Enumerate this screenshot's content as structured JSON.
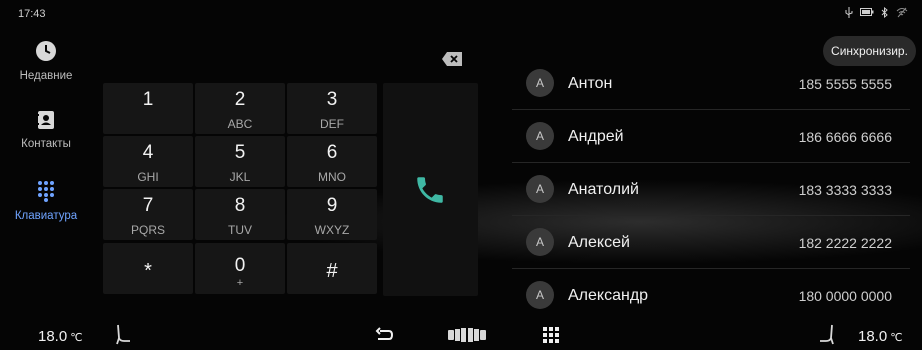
{
  "status": {
    "time": "17:43",
    "icons": [
      "usb-icon",
      "battery-icon",
      "bluetooth-icon",
      "wifi-off-icon"
    ]
  },
  "sidebar": {
    "items": [
      {
        "label": "Недавние",
        "icon": "clock-icon",
        "active": false
      },
      {
        "label": "Контакты",
        "icon": "contacts-book-icon",
        "active": false
      },
      {
        "label": "Клавиатура",
        "icon": "dialpad-icon",
        "active": true
      }
    ]
  },
  "keypad": {
    "keys": [
      {
        "digit": "1",
        "letters": ""
      },
      {
        "digit": "2",
        "letters": "ABC"
      },
      {
        "digit": "3",
        "letters": "DEF"
      },
      {
        "digit": "4",
        "letters": "GHI"
      },
      {
        "digit": "5",
        "letters": "JKL"
      },
      {
        "digit": "6",
        "letters": "MNO"
      },
      {
        "digit": "7",
        "letters": "PQRS"
      },
      {
        "digit": "8",
        "letters": "TUV"
      },
      {
        "digit": "9",
        "letters": "WXYZ"
      },
      {
        "digit": "*",
        "letters": ""
      },
      {
        "digit": "0",
        "letters": "+"
      },
      {
        "digit": "#",
        "letters": ""
      }
    ],
    "call_icon": "phone-icon",
    "call_color": "#3fb8a4",
    "delete_icon": "backspace-icon"
  },
  "contacts": {
    "sync_label": "Синхронизир.",
    "items": [
      {
        "initial": "A",
        "name": "Антон",
        "phone": "185 5555 5555"
      },
      {
        "initial": "A",
        "name": "Андрей",
        "phone": "186 6666 6666"
      },
      {
        "initial": "A",
        "name": "Анатолий",
        "phone": "183 3333 3333"
      },
      {
        "initial": "A",
        "name": "Алексей",
        "phone": "182 2222 2222"
      },
      {
        "initial": "A",
        "name": "Александр",
        "phone": "180 0000 0000"
      }
    ]
  },
  "bottombar": {
    "left_temp": "18.0",
    "right_temp": "18.0",
    "unit": "℃",
    "icons": [
      "seat-left-icon",
      "back-icon",
      "car-logo-icon",
      "apps-grid-icon",
      "seat-right-icon"
    ]
  },
  "colors": {
    "active_nav": "#6fa3ff",
    "accent_call": "#3fb8a4"
  }
}
